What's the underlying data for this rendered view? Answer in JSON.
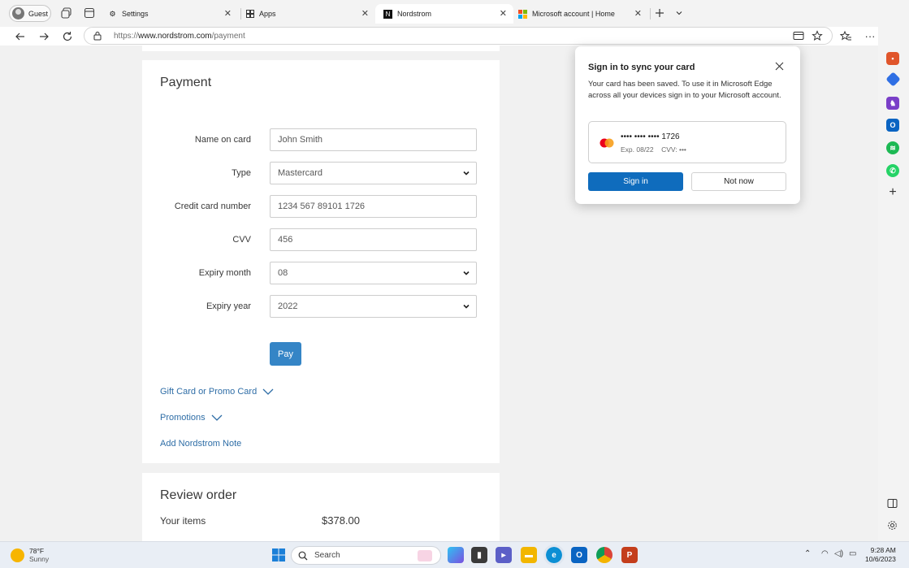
{
  "browser": {
    "profile_label": "Guest",
    "tabs": [
      {
        "label": "Settings",
        "active": false
      },
      {
        "label": "Apps",
        "active": false
      },
      {
        "label": "Nordstrom",
        "active": true
      },
      {
        "label": "Microsoft account | Home",
        "active": false
      }
    ],
    "url_prefix": "https://",
    "url_domain": "www.nordstrom.com",
    "url_path": "/payment"
  },
  "payment": {
    "heading": "Payment",
    "fields": [
      {
        "label": "Name on card",
        "value": "John Smith",
        "type": "text"
      },
      {
        "label": "Type",
        "value": "Mastercard",
        "type": "select"
      },
      {
        "label": "Credit card number",
        "value": "1234 567 89101 1726",
        "type": "text"
      },
      {
        "label": "CVV",
        "value": "456",
        "type": "text"
      },
      {
        "label": "Expiry month",
        "value": "08",
        "type": "select"
      },
      {
        "label": "Expiry year",
        "value": "2022",
        "type": "select"
      }
    ],
    "pay_label": "Pay",
    "gift_card_link": "Gift Card or Promo Card",
    "promotions_link": "Promotions",
    "note_link": "Add Nordstrom Note"
  },
  "review": {
    "heading": "Review order",
    "items_label": "Your items",
    "items_value": "$378.00"
  },
  "sync_popup": {
    "title": "Sign in to sync your card",
    "message": "Your card has been saved. To use it in Microsoft Edge across all your devices sign in to your Microsoft account.",
    "card_number": "•••• •••• •••• 1726",
    "card_meta": "Exp. 08/22    CVV: •••",
    "sign_in_label": "Sign in",
    "not_now_label": "Not now"
  },
  "taskbar": {
    "temperature": "78°F",
    "condition": "Sunny",
    "search_placeholder": "Search",
    "time": "9:28 AM",
    "date": "10/6/2023"
  },
  "colors": {
    "accent": "#0f6cbd",
    "pay_button": "#3585c6",
    "link": "#2e6da6"
  }
}
